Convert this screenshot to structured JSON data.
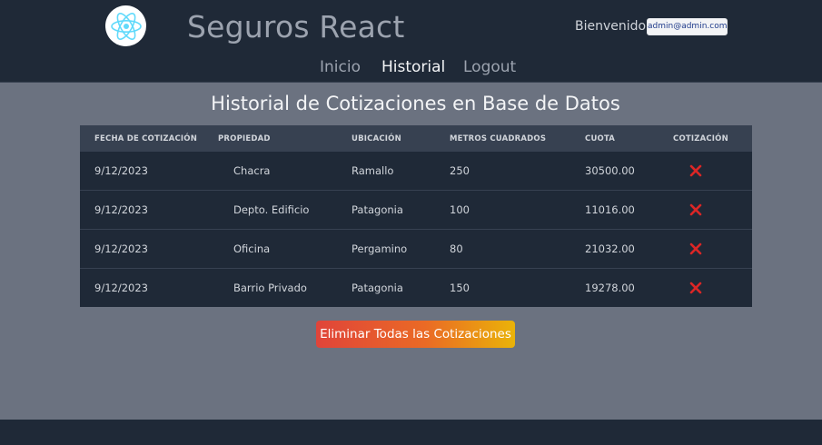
{
  "header": {
    "title": "Seguros React",
    "welcome_label": "Bienvenido:",
    "user_email": "admin@admin.com"
  },
  "nav": {
    "items": [
      {
        "label": "Inicio",
        "active": false
      },
      {
        "label": "Historial",
        "active": true
      },
      {
        "label": "Logout",
        "active": false
      }
    ]
  },
  "main": {
    "title": "Historial de Cotizaciones en Base de Datos",
    "table": {
      "columns": [
        "FECHA DE COTIZACIÓN",
        "PROPIEDAD",
        "UBICACIÓN",
        "METROS CUADRADOS",
        "CUOTA",
        "COTIZACIÓN"
      ],
      "rows": [
        {
          "fecha": "9/12/2023",
          "propiedad": "Chacra",
          "ubicacion": "Ramallo",
          "metros": "250",
          "cuota": "30500.00"
        },
        {
          "fecha": "9/12/2023",
          "propiedad": "Depto. Edificio",
          "ubicacion": "Patagonia",
          "metros": "100",
          "cuota": "11016.00"
        },
        {
          "fecha": "9/12/2023",
          "propiedad": "Oficina",
          "ubicacion": "Pergamino",
          "metros": "80",
          "cuota": "21032.00"
        },
        {
          "fecha": "9/12/2023",
          "propiedad": "Barrio Privado",
          "ubicacion": "Patagonia",
          "metros": "150",
          "cuota": "19278.00"
        }
      ]
    },
    "clear_button_label": "Eliminar Todas las Cotizaciones"
  },
  "icons": {
    "logo": "react-atom-icon",
    "delete": "close-x-icon"
  },
  "colors": {
    "header_bg": "#1f2937",
    "page_bg": "#6b7280",
    "delete_red": "#dc2626"
  }
}
